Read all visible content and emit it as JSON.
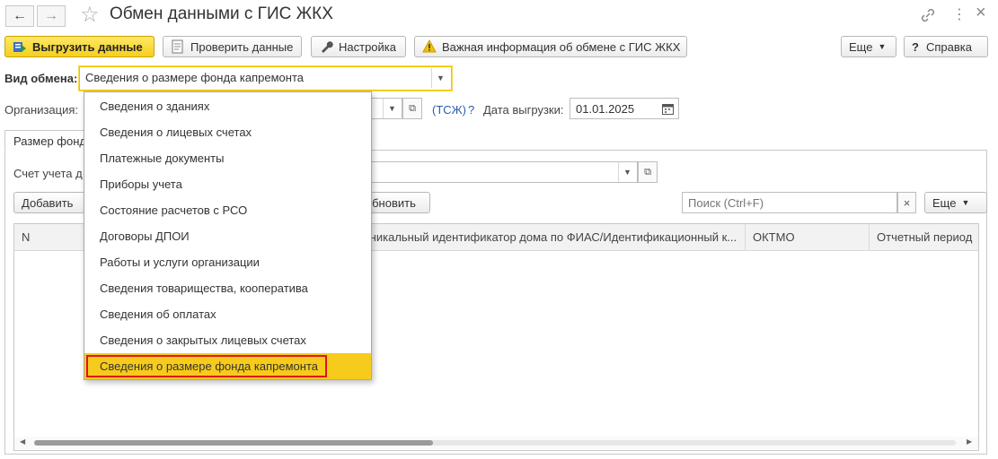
{
  "window": {
    "title": "Обмен данными с ГИС ЖКХ",
    "nav_back": "←",
    "nav_forward": "→",
    "star": "☆",
    "link_icon": "🔗",
    "more_icon": "⋮",
    "close_icon": "×"
  },
  "toolbar": {
    "upload_label": "Выгрузить данные",
    "check_label": "Проверить данные",
    "settings_label": "Настройка",
    "important_label": "Важная информация об обмене с ГИС ЖКХ",
    "more_label": "Еще",
    "help_label": "Справка",
    "help_icon": "?"
  },
  "form": {
    "exchange_type_label": "Вид обмена:",
    "exchange_type_value": "Сведения о размере фонда капремонта",
    "organization_label": "Организация:",
    "org_link": "(ТСЖ)",
    "org_help": "?",
    "upload_date_label": "Дата выгрузки:",
    "upload_date_value": "01.01.2025"
  },
  "tab": {
    "label": "Размер фонда"
  },
  "inner": {
    "account_label": "Счет учета д",
    "add_label": "Добавить",
    "refresh_label": "Обновить",
    "search_placeholder": "Поиск (Ctrl+F)",
    "clear_icon": "×",
    "more_label": "Еще"
  },
  "table": {
    "columns": [
      "N",
      "Уникальный идентификатор дома по ФИАС/Идентификационный к...",
      "ОКТМО",
      "Отчетный период"
    ],
    "rows": []
  },
  "dropdown": {
    "items": [
      "Сведения о зданиях",
      "Сведения о лицевых счетах",
      "Платежные документы",
      "Приборы учета",
      "Состояние расчетов с РСО",
      "Договоры ДПОИ",
      "Работы и услуги организации",
      "Сведения товарищества, кооператива",
      "Сведения об оплатах",
      "Сведения о закрытых лицевых счетах",
      "Сведения о размере фонда капремонта"
    ],
    "selected_index": 10
  },
  "colors": {
    "accent": "#f7cb1c",
    "highlight_border": "#e0141c",
    "link": "#2a5db0"
  }
}
